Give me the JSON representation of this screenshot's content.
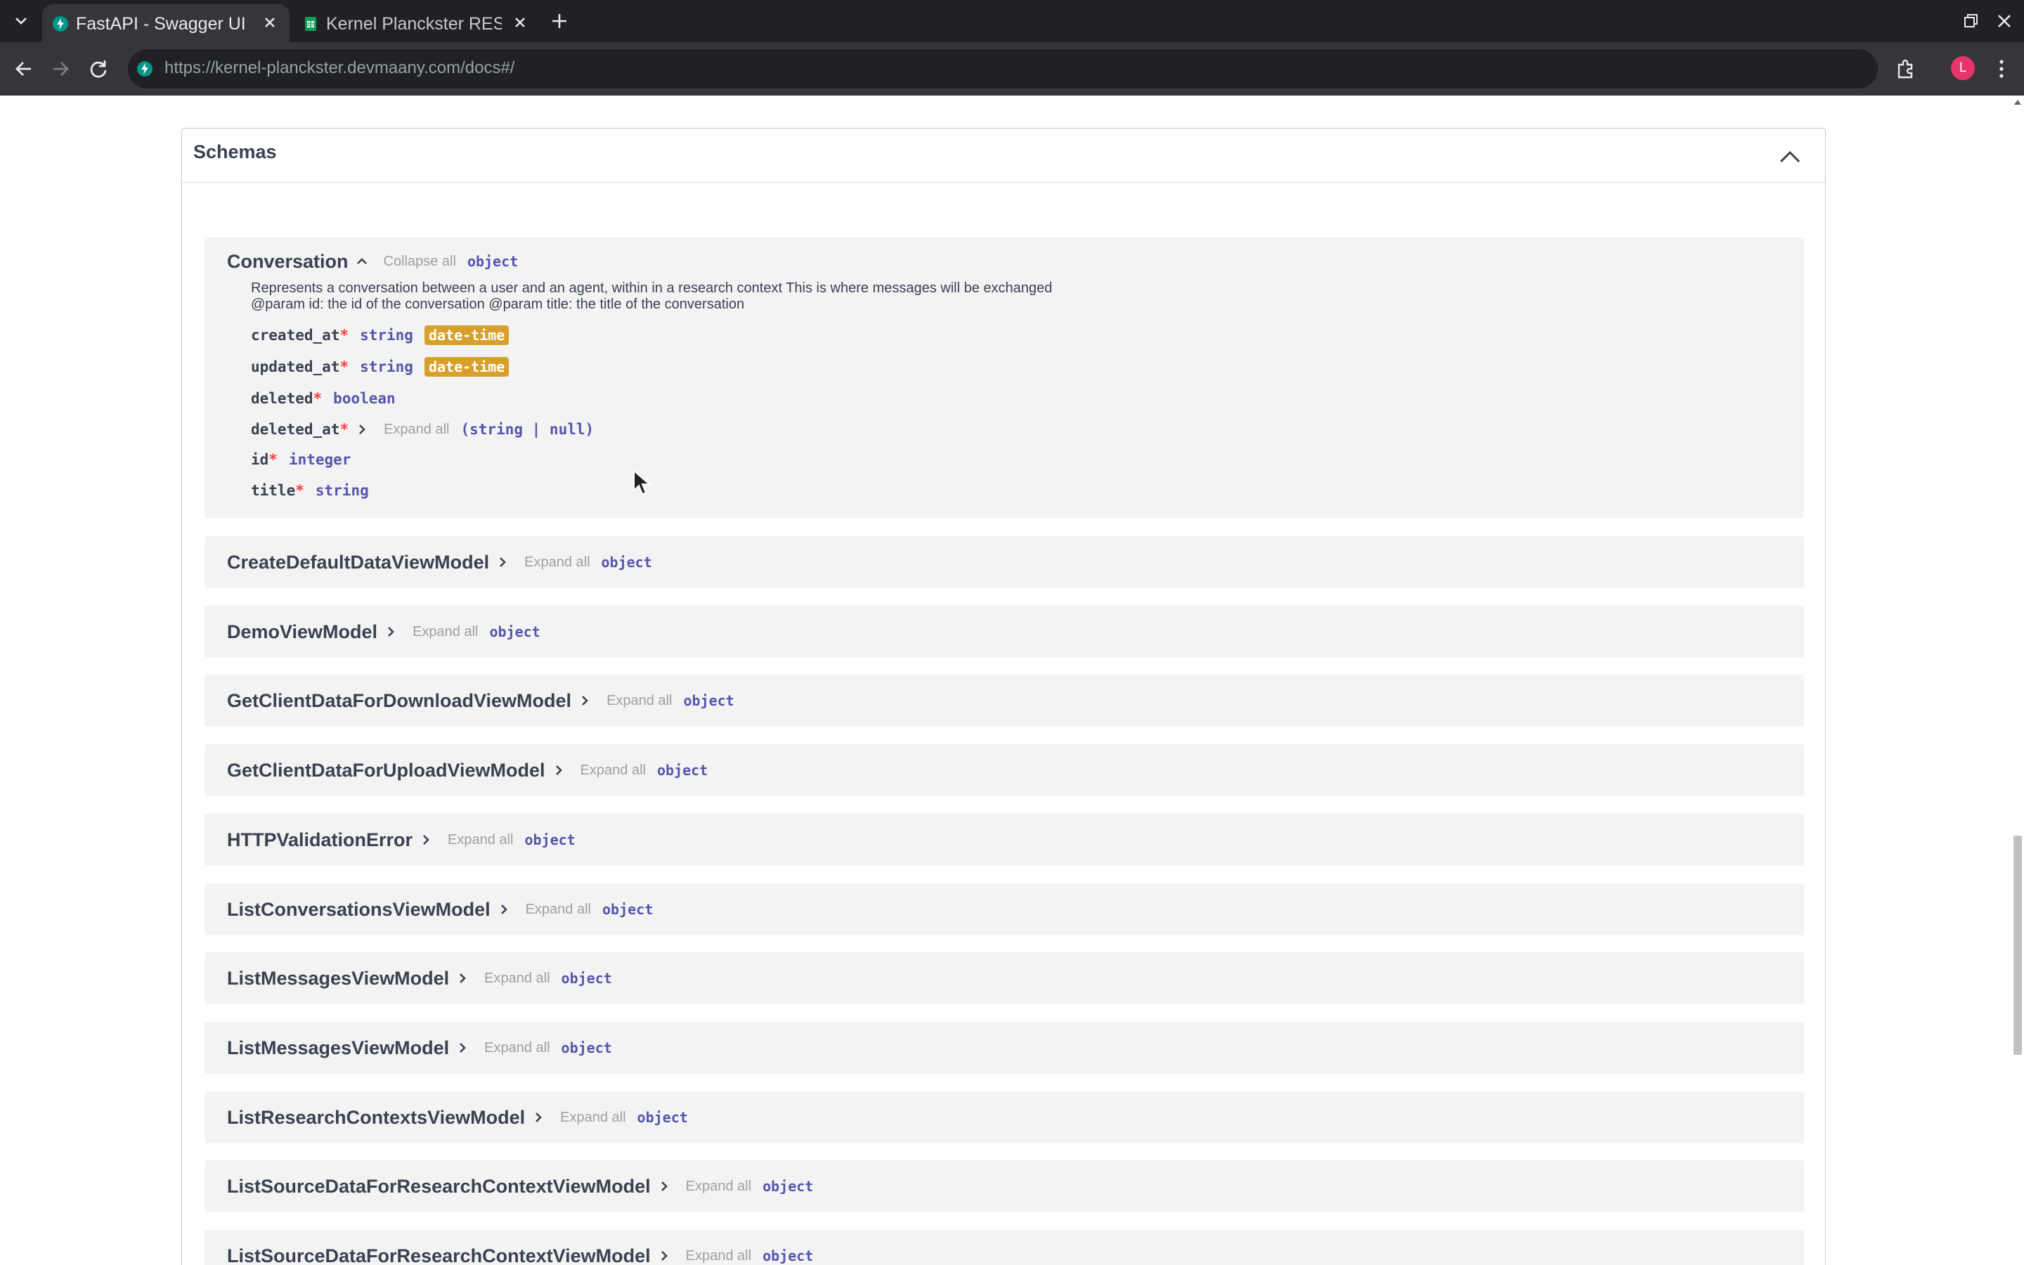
{
  "browser": {
    "tabs": [
      {
        "title": "FastAPI - Swagger UI",
        "active": true
      },
      {
        "title": "Kernel Planckster RES",
        "active": false
      }
    ],
    "url_host": "https://kernel-planckster.devmaany.com",
    "url_path": "/docs#/",
    "profile_initial": "L"
  },
  "schemas": {
    "title": "Schemas",
    "conversation": {
      "name": "Conversation",
      "collapse_label": "Collapse all",
      "type": "object",
      "description_line1": "Represents a conversation between a user and an agent, within in a research context This is where messages will be exchanged",
      "description_line2": "@param id: the id of the conversation @param title: the title of the conversation",
      "properties": [
        {
          "name": "created_at",
          "required": "*",
          "type": "string",
          "format": "date-time"
        },
        {
          "name": "updated_at",
          "required": "*",
          "type": "string",
          "format": "date-time"
        },
        {
          "name": "deleted",
          "required": "*",
          "type": "boolean"
        },
        {
          "name": "deleted_at",
          "required": "*",
          "expand": "Expand all",
          "type": "(string | null)"
        },
        {
          "name": "id",
          "required": "*",
          "type": "integer"
        },
        {
          "name": "title",
          "required": "*",
          "type": "string"
        }
      ]
    },
    "expand_label": "Expand all",
    "models": [
      {
        "name": "CreateDefaultDataViewModel",
        "type": "object"
      },
      {
        "name": "DemoViewModel",
        "type": "object"
      },
      {
        "name": "GetClientDataForDownloadViewModel",
        "type": "object"
      },
      {
        "name": "GetClientDataForUploadViewModel",
        "type": "object"
      },
      {
        "name": "HTTPValidationError",
        "type": "object"
      },
      {
        "name": "ListConversationsViewModel",
        "type": "object"
      },
      {
        "name": "ListMessagesViewModel",
        "type": "object"
      },
      {
        "name": "ListMessagesViewModel",
        "type": "object"
      },
      {
        "name": "ListResearchContextsViewModel",
        "type": "object"
      },
      {
        "name": "ListSourceDataForResearchContextViewModel",
        "type": "object"
      },
      {
        "name": "ListSourceDataForResearchContextViewModel",
        "type": "object"
      }
    ]
  }
}
